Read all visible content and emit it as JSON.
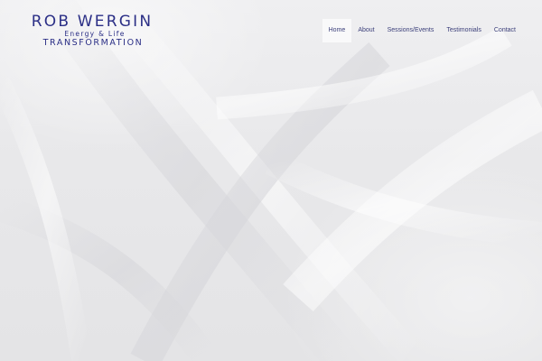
{
  "logo": {
    "name": "ROB WERGIN",
    "tagline": "Energy & Life",
    "subtitle": "TRANSFORMATION"
  },
  "nav": {
    "items": [
      {
        "label": "Home",
        "active": true
      },
      {
        "label": "About",
        "active": false
      },
      {
        "label": "Sessions/Events",
        "active": false
      },
      {
        "label": "Testimonials",
        "active": false
      },
      {
        "label": "Contact",
        "active": false
      }
    ]
  },
  "colors": {
    "brand": "#2b2f86",
    "nav_text": "#3b3f7a",
    "background": "#e8e8ea"
  }
}
